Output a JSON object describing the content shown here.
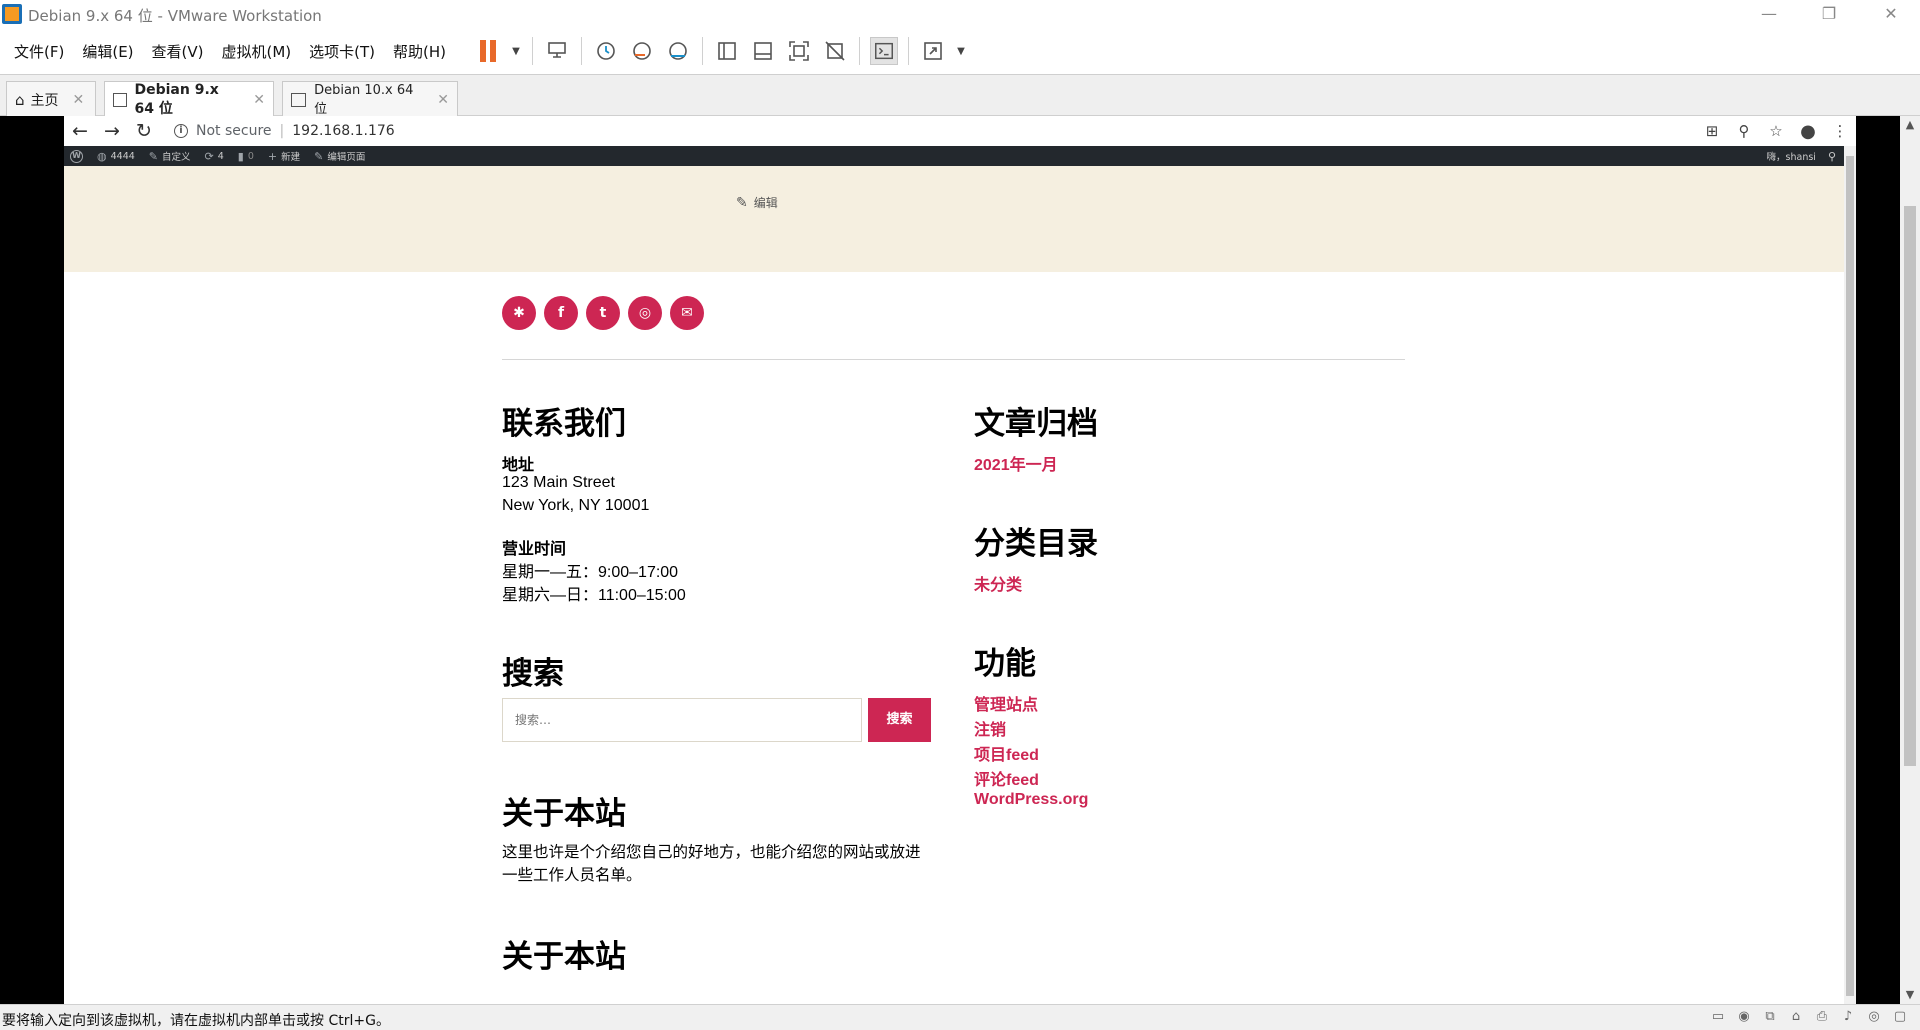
{
  "window": {
    "title": "Debian 9.x 64 位 - VMware Workstation",
    "minimize": "—",
    "maximize": "❐",
    "close": "✕"
  },
  "menu": [
    "文件(F)",
    "编辑(E)",
    "查看(V)",
    "虚拟机(M)",
    "选项卡(T)",
    "帮助(H)"
  ],
  "vm_tabs": [
    {
      "label": "主页",
      "close": "✕"
    },
    {
      "label": "Debian 9.x 64 位",
      "close": "✕"
    },
    {
      "label": "Debian 10.x 64 位",
      "close": "✕"
    }
  ],
  "browser": {
    "security": "Not secure",
    "url": "192.168.1.176"
  },
  "wp_admin_bar": {
    "site": "4444",
    "customize": "自定义",
    "updates": "4",
    "comments": "0",
    "new": "新建",
    "edit_page": "编辑页面",
    "user": "嗨，shansi"
  },
  "page": {
    "edit_link": "编辑",
    "contact": {
      "title": "联系我们",
      "address_label": "地址",
      "address_line1": "123 Main Street",
      "address_line2": "New York, NY 10001",
      "hours_label": "营业时间",
      "hours_line1": "星期一—五：9:00–17:00",
      "hours_line2": "星期六—日：11:00–15:00"
    },
    "search": {
      "title": "搜索",
      "placeholder": "搜索…",
      "button": "搜索"
    },
    "about1": {
      "title": "关于本站",
      "text": "这里也许是个介绍您自己的好地方，也能介绍您的网站或放进一些工作人员名单。"
    },
    "about2": {
      "title": "关于本站"
    },
    "archives": {
      "title": "文章归档",
      "items": [
        "2021年一月"
      ]
    },
    "categories": {
      "title": "分类目录",
      "items": [
        "未分类"
      ]
    },
    "meta": {
      "title": "功能",
      "items": [
        "管理站点",
        "注销",
        "项目feed",
        "评论feed",
        "WordPress.org"
      ]
    }
  },
  "status": {
    "message": "要将输入定向到该虚拟机，请在虚拟机内部单击或按 Ctrl+G。"
  },
  "colors": {
    "accent": "#cd2653",
    "beige": "#f5efe0",
    "admin_bar": "#23282d"
  }
}
